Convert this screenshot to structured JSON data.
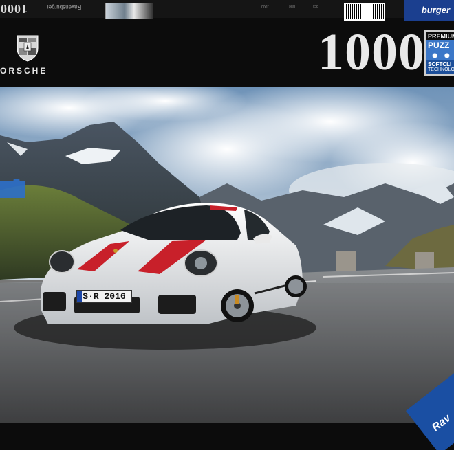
{
  "top_edge": {
    "flipped_piece_count": "1000",
    "flipped_brand_label": "Ravensburger",
    "fine_print": [
      "1000",
      "Teile",
      "pcs"
    ]
  },
  "corner_logo": {
    "label": "burger"
  },
  "brand": {
    "wordmark": "PORSCHE",
    "visible_wordmark": "ORSCHE"
  },
  "piece_count": "1000",
  "premium_badge": {
    "line1": "PREMIUM",
    "line2": "PUZZ",
    "line3": "SOFTCLI",
    "line4": "TECHNOLO"
  },
  "car": {
    "license_plate": "S·R 2016",
    "body_color": "#f1f1f1",
    "stripe_color": "#c8202a"
  },
  "bottom": {
    "corner_brand": "Rav"
  },
  "colors": {
    "box_black": "#0c0c0c",
    "ravensburger_blue": "#1a4fa3",
    "sky": "#7fa3c6"
  }
}
